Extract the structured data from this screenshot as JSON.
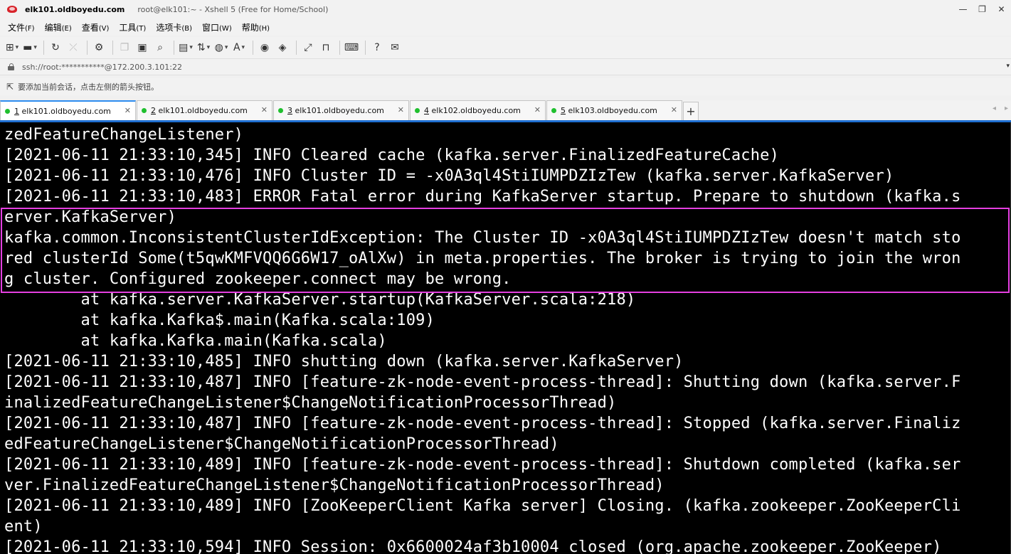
{
  "window": {
    "host": "elk101.oldboyedu.com",
    "title_rest": "root@elk101:~ - Xshell 5 (Free for Home/School)",
    "min": "—",
    "restore": "❐",
    "close": "✕"
  },
  "menu": [
    {
      "label": "文件",
      "acc": "(F)"
    },
    {
      "label": "编辑",
      "acc": "(E)"
    },
    {
      "label": "查看",
      "acc": "(V)"
    },
    {
      "label": "工具",
      "acc": "(T)"
    },
    {
      "label": "选项卡",
      "acc": "(B)"
    },
    {
      "label": "窗口",
      "acc": "(W)"
    },
    {
      "label": "帮助",
      "acc": "(H)"
    }
  ],
  "address": {
    "value": "ssh://root:***********@172.200.3.101:22"
  },
  "hint": {
    "text": "要添加当前会话，点击左侧的箭头按钮。"
  },
  "tabs": [
    {
      "num": "1",
      "label": "elk101.oldboyedu.com",
      "active": true
    },
    {
      "num": "2",
      "label": "elk101.oldboyedu.com",
      "active": false
    },
    {
      "num": "3",
      "label": "elk101.oldboyedu.com",
      "active": false
    },
    {
      "num": "4",
      "label": "elk102.oldboyedu.com",
      "active": false
    },
    {
      "num": "5",
      "label": "elk103.oldboyedu.com",
      "active": false
    }
  ],
  "terminal": {
    "lines": [
      "zedFeatureChangeListener)",
      "[2021-06-11 21:33:10,345] INFO Cleared cache (kafka.server.FinalizedFeatureCache)",
      "[2021-06-11 21:33:10,476] INFO Cluster ID = -x0A3ql4StiIUMPDZIzTew (kafka.server.KafkaServer)",
      "[2021-06-11 21:33:10,483] ERROR Fatal error during KafkaServer startup. Prepare to shutdown (kafka.s",
      "erver.KafkaServer)",
      "kafka.common.InconsistentClusterIdException: The Cluster ID -x0A3ql4StiIUMPDZIzTew doesn't match sto",
      "red clusterId Some(t5qwKMFVQQ6G6W17_oAlXw) in meta.properties. The broker is trying to join the wron",
      "g cluster. Configured zookeeper.connect may be wrong.",
      "        at kafka.server.KafkaServer.startup(KafkaServer.scala:218)",
      "        at kafka.Kafka$.main(Kafka.scala:109)",
      "        at kafka.Kafka.main(Kafka.scala)",
      "[2021-06-11 21:33:10,485] INFO shutting down (kafka.server.KafkaServer)",
      "[2021-06-11 21:33:10,487] INFO [feature-zk-node-event-process-thread]: Shutting down (kafka.server.F",
      "inalizedFeatureChangeListener$ChangeNotificationProcessorThread)",
      "[2021-06-11 21:33:10,487] INFO [feature-zk-node-event-process-thread]: Stopped (kafka.server.Finaliz",
      "edFeatureChangeListener$ChangeNotificationProcessorThread)",
      "[2021-06-11 21:33:10,489] INFO [feature-zk-node-event-process-thread]: Shutdown completed (kafka.ser",
      "ver.FinalizedFeatureChangeListener$ChangeNotificationProcessorThread)",
      "[2021-06-11 21:33:10,489] INFO [ZooKeeperClient Kafka server] Closing. (kafka.zookeeper.ZooKeeperCli",
      "ent)",
      "[2021-06-11 21:33:10,594] INFO Session: 0x6600024af3b10004 closed (org.apache.zookeeper.ZooKeeper)"
    ],
    "highlight_color": "#e53fe0"
  },
  "colors": {
    "tab_dot": "#1fbf2e",
    "tab_active_accent": "#1f6fd1",
    "terminal_bg": "#000000",
    "terminal_fg": "#ffffff"
  }
}
